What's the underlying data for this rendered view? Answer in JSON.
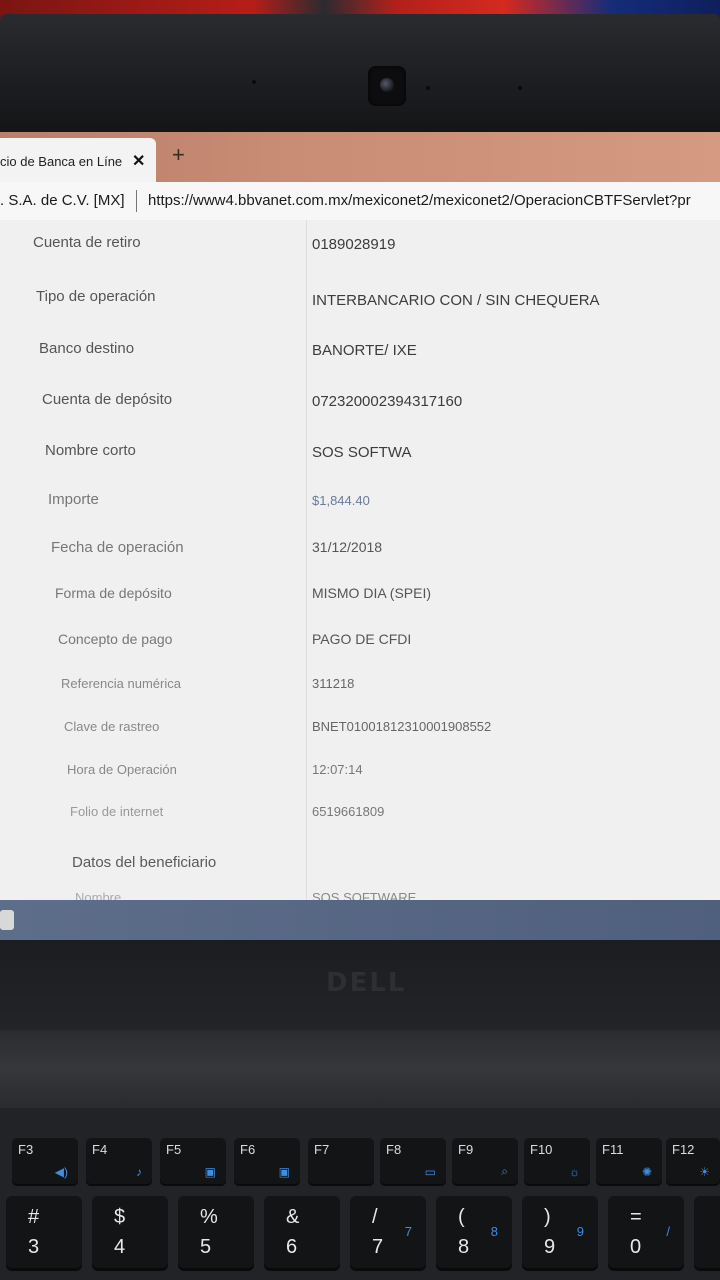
{
  "browser": {
    "tab_title": "cio de Banca en Líne",
    "tab_close": "✕",
    "new_tab": "+",
    "cert_label": ". S.A. de C.V. [MX]",
    "url": "https://www4.bbvanet.com.mx/mexiconet2/mexiconet2/OperacionCBTFServlet?pr"
  },
  "details": [
    {
      "label": "Cuenta de retiro",
      "value": "0189028919"
    },
    {
      "label": "Tipo de operación",
      "value": "INTERBANCARIO CON / SIN CHEQUERA"
    },
    {
      "label": "Banco destino",
      "value": "BANORTE/ IXE"
    },
    {
      "label": "Cuenta de depósito",
      "value": "072320002394317160"
    },
    {
      "label": "Nombre corto",
      "value": "SOS SOFTWA"
    },
    {
      "label": "Importe",
      "value": "$1,844.40"
    },
    {
      "label": "Fecha de operación",
      "value": "31/12/2018"
    },
    {
      "label": "Forma de depósito",
      "value": "MISMO DIA (SPEI)"
    },
    {
      "label": "Concepto de pago",
      "value": "PAGO DE CFDI"
    },
    {
      "label": "Referencia numérica",
      "value": "311218"
    },
    {
      "label": "Clave de rastreo",
      "value": "BNET01001812310001908552"
    },
    {
      "label": "Hora de Operación",
      "value": "12:07:14"
    },
    {
      "label": "Folio de internet",
      "value": "6519661809"
    }
  ],
  "beneficiary": {
    "section_title": "Datos del beneficiario",
    "name_label": "Nombre",
    "name_value": "SOS SOFTWARE"
  },
  "laptop": {
    "logo": "DELL"
  },
  "fkeys": [
    "F3",
    "F4",
    "F5",
    "F6",
    "F7",
    "F8",
    "F9",
    "F10",
    "F11",
    "F12"
  ],
  "numkeys": [
    {
      "sym": "#",
      "dig": "3",
      "kp": ""
    },
    {
      "sym": "$",
      "dig": "4",
      "kp": ""
    },
    {
      "sym": "%",
      "dig": "5",
      "kp": ""
    },
    {
      "sym": "&",
      "dig": "6",
      "kp": ""
    },
    {
      "sym": "/",
      "dig": "7",
      "kp": "7"
    },
    {
      "sym": "(",
      "dig": "8",
      "kp": "8"
    },
    {
      "sym": ")",
      "dig": "9",
      "kp": "9"
    },
    {
      "sym": "=",
      "dig": "0",
      "kp": "/"
    }
  ],
  "colors": {
    "keypad_blue": "#3d8de0",
    "screen_bg": "#f0f0f0",
    "tabbar": "#c98c74"
  }
}
